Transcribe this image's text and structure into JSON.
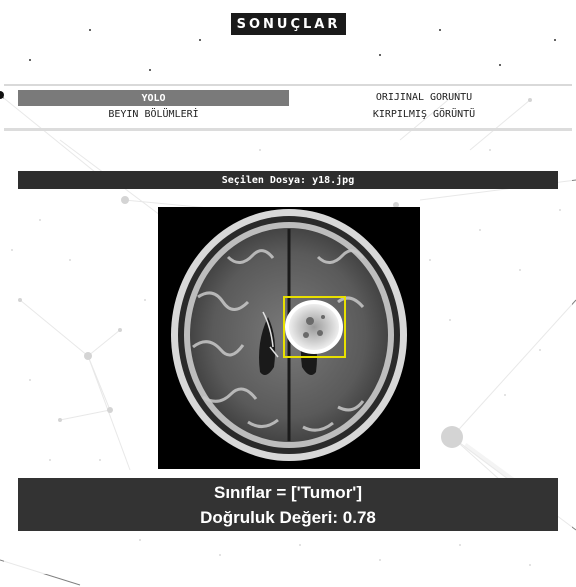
{
  "header": {
    "title": "SONUÇLAR"
  },
  "nav": {
    "yolo_label": "YOLO",
    "beyin_label": "BEYIN BÖLÜMLERİ",
    "orijinal_label": "ORIJINAL GORUNTU",
    "kirpilmis_label": "KIRPILMIŞ GÖRÜNTÜ"
  },
  "file": {
    "label": "Seçilen Dosya: y18.jpg"
  },
  "results": {
    "classes_text": "Sınıflar = ['Tumor']",
    "accuracy_text": "Doğruluk Değeri: 0.78"
  },
  "colors": {
    "title_bg": "#1a1a1a",
    "active_nav_bg": "#7a7a7a",
    "file_bar_bg": "#2e2e2e",
    "results_bg": "#333333",
    "detection_box": "#e8e000"
  },
  "icons": {
    "background": "network-particles-decoration"
  }
}
